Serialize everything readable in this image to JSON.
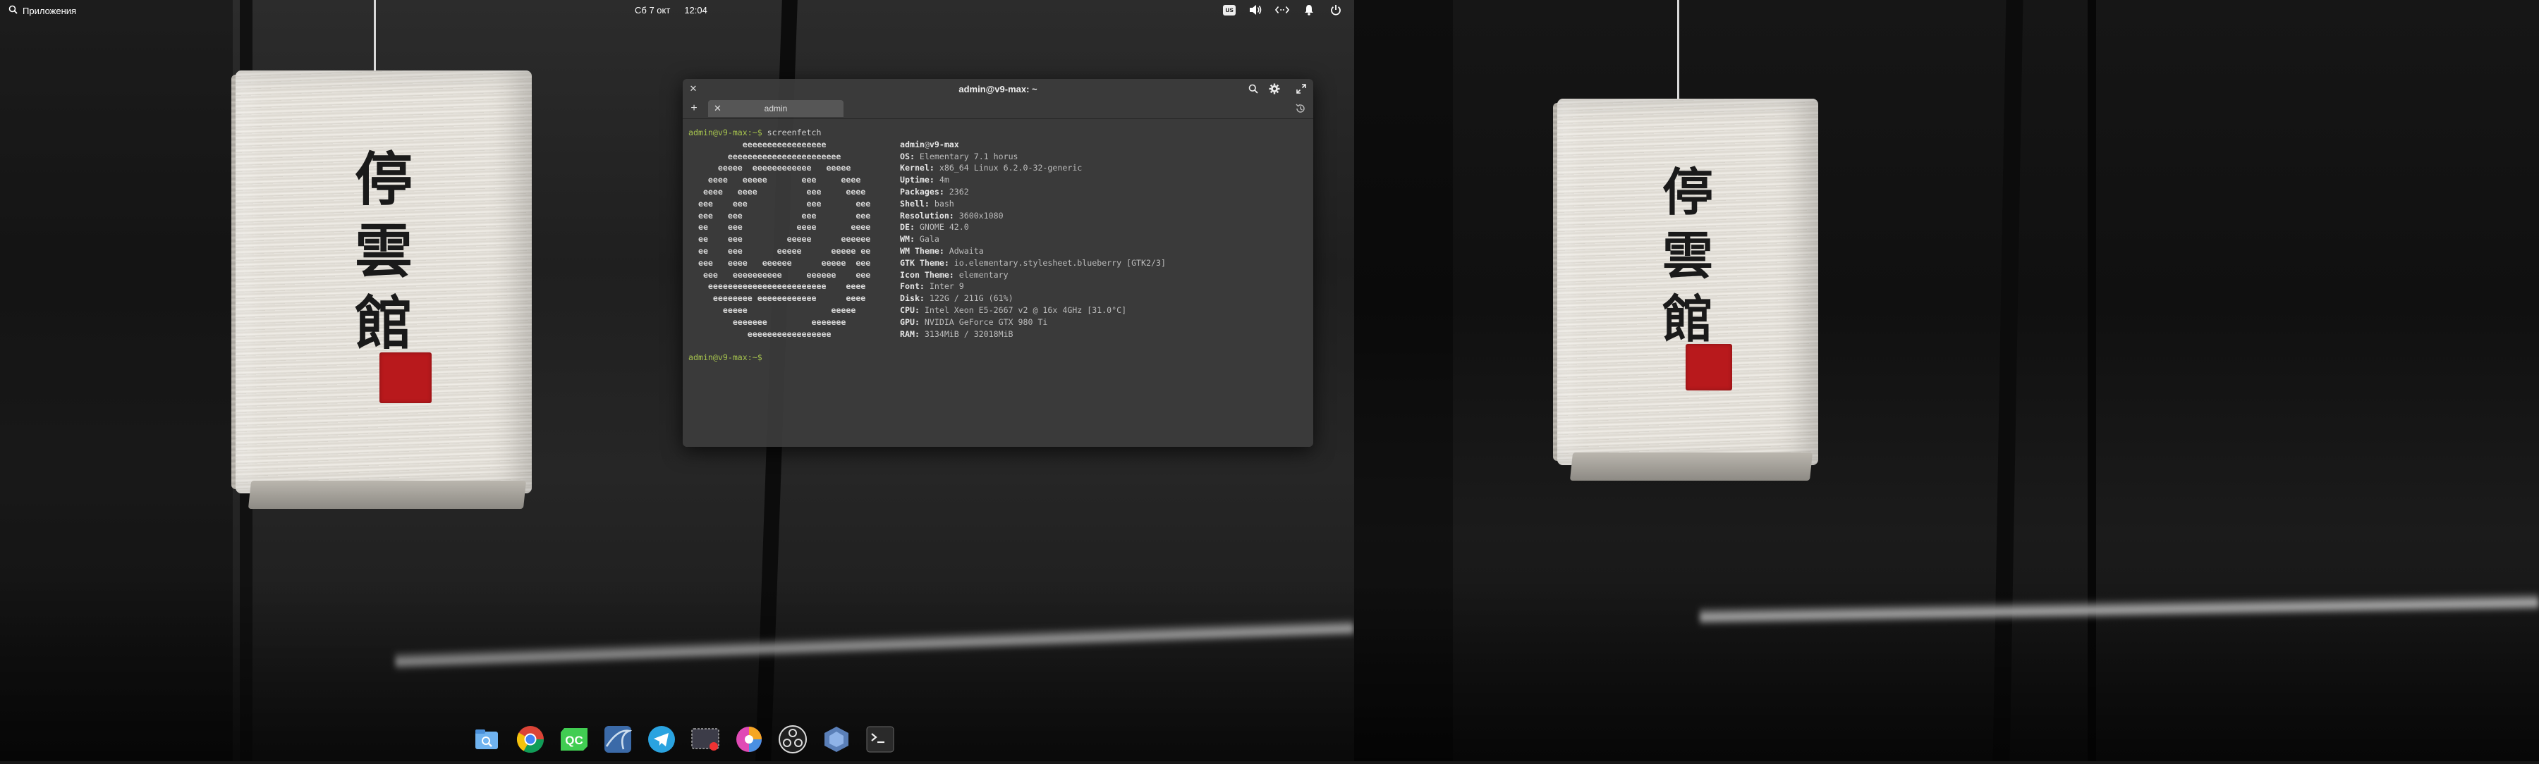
{
  "panel": {
    "apps_label": "Приложения",
    "date": "Сб 7 окт",
    "time": "12:04",
    "keyboard_layout": "us"
  },
  "terminal": {
    "title": "admin@v9-max: ~",
    "tab_label": "admin",
    "prompt": "admin@v9-max:~$",
    "command": " screenfetch",
    "logo_lines": [
      "           eeeeeeeeeeeeeeeee",
      "        eeeeeeeeeeeeeeeeeeeeeee",
      "      eeeee  eeeeeeeeeeee   eeeee",
      "    eeee   eeeee       eee     eeee",
      "   eeee   eeee          eee     eeee",
      "  eee    eee            eee       eee",
      "  eee   eee            eee        eee",
      "  ee    eee           eeee       eeee",
      "  ee    eee         eeeee      eeeeee",
      "  ee    eee       eeeee      eeeee ee",
      "  eee   eeee   eeeeee      eeeee  eee",
      "   eee   eeeeeeeeee     eeeeee    eee",
      "    eeeeeeeeeeeeeeeeeeeeeeee    eeee",
      "     eeeeeeee eeeeeeeeeeee      eeee",
      "       eeeee                 eeeee",
      "         eeeeeee         eeeeeee",
      "            eeeeeeeeeeeeeeeee"
    ],
    "info": {
      "user": "admin",
      "at": "@",
      "host": "v9-max",
      "rows": [
        {
          "key": "OS:",
          "value": " Elementary 7.1 horus"
        },
        {
          "key": "Kernel:",
          "value": " x86_64 Linux 6.2.0-32-generic"
        },
        {
          "key": "Uptime:",
          "value": " 4m"
        },
        {
          "key": "Packages:",
          "value": " 2362"
        },
        {
          "key": "Shell:",
          "value": " bash"
        },
        {
          "key": "Resolution:",
          "value": " 3600x1080"
        },
        {
          "key": "DE:",
          "value": " GNOME 42.0"
        },
        {
          "key": "WM:",
          "value": " Gala"
        },
        {
          "key": "WM Theme:",
          "value": " Adwaita"
        },
        {
          "key": "GTK Theme:",
          "value": " io.elementary.stylesheet.blueberry [GTK2/3]"
        },
        {
          "key": "Icon Theme:",
          "value": " elementary"
        },
        {
          "key": "Font:",
          "value": " Inter 9"
        },
        {
          "key": "Disk:",
          "value": " 122G / 211G (61%)"
        },
        {
          "key": "CPU:",
          "value": " Intel Xeon E5-2667 v2 @ 16x 4GHz [31.0°C]"
        },
        {
          "key": "GPU:",
          "value": " NVIDIA GeForce GTX 980 Ti"
        },
        {
          "key": "RAM:",
          "value": " 3134MiB / 32018MiB"
        }
      ]
    },
    "final_prompt": "admin@v9-max:~$"
  },
  "wallpaper": {
    "kanji_1": "停",
    "kanji_2": "雲",
    "kanji_3": "館"
  },
  "dock": {
    "items": [
      {
        "name": "files-icon",
        "color": "#3d8fe0"
      },
      {
        "name": "chrome-icon",
        "color": "#e8453c"
      },
      {
        "name": "qt-creator-icon",
        "color": "#41cd52"
      },
      {
        "name": "wireshark-icon",
        "color": "#4a6fa0"
      },
      {
        "name": "telegram-icon",
        "color": "#2aa3e0"
      },
      {
        "name": "screen-recorder-icon",
        "color": "#4a4a5a"
      },
      {
        "name": "color-picker-icon",
        "color": "#c94ab0"
      },
      {
        "name": "obs-icon",
        "color": "#202020"
      },
      {
        "name": "app-icon",
        "color": "#5a7fb8"
      },
      {
        "name": "terminal-icon",
        "color": "#2a2a2a"
      }
    ]
  }
}
